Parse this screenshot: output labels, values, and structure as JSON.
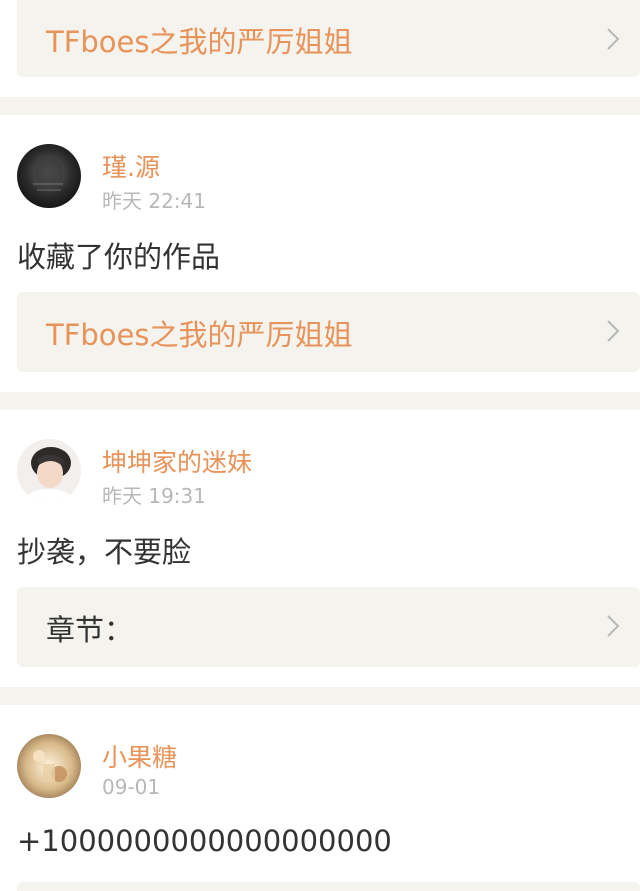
{
  "notifications": [
    {
      "link": {
        "label": "TFboes之我的严厉姐姐"
      }
    },
    {
      "user": "瑾.源",
      "time": "昨天 22:41",
      "content": "收藏了你的作品",
      "link": {
        "label": "TFboes之我的严厉姐姐"
      }
    },
    {
      "user": "坤坤家的迷妹",
      "time": "昨天 19:31",
      "content": "抄袭，不要脸",
      "link": {
        "label": "章节："
      }
    },
    {
      "user": "小果糖",
      "time": "09-01",
      "content": "+1000000000000000000"
    }
  ],
  "colors": {
    "accent": "#e8935a",
    "text": "#333333",
    "muted": "#b8b8b8",
    "background": "#f4f3ee"
  },
  "icons": {
    "chevron": "chevron-right-icon"
  }
}
